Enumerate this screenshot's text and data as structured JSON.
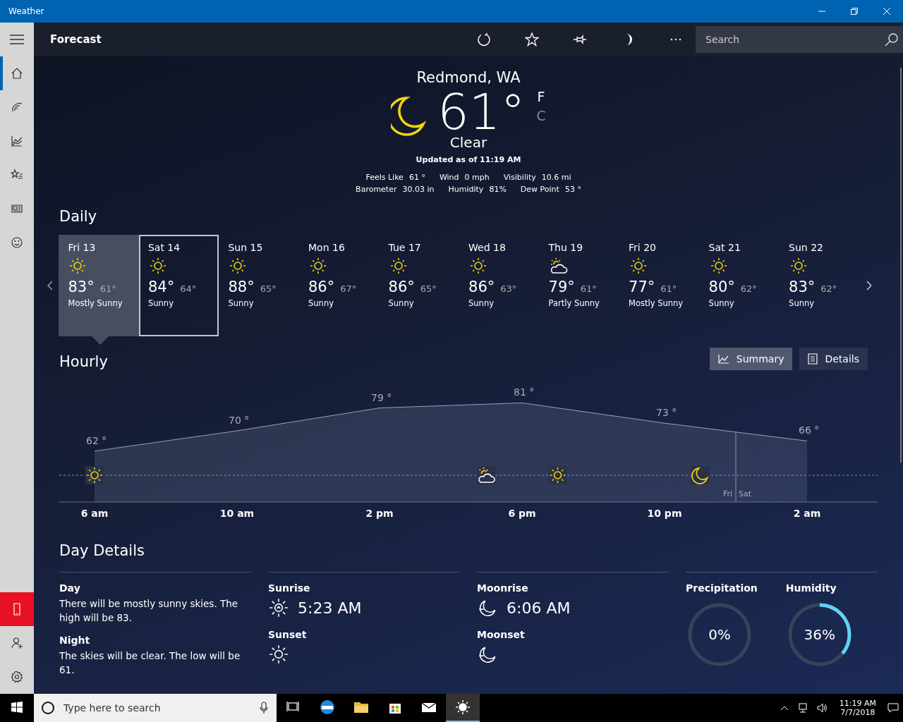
{
  "window": {
    "title": "Weather"
  },
  "sidebar": {
    "items": [
      {
        "selected": true
      },
      {
        "selected": false
      },
      {
        "selected": false
      },
      {
        "selected": false
      },
      {
        "selected": false
      },
      {
        "selected": false
      }
    ],
    "bottom_items": [
      {
        "highlighted": true
      },
      {
        "highlighted": false
      },
      {
        "highlighted": false
      }
    ]
  },
  "header": {
    "title": "Forecast",
    "search": {
      "placeholder": "Search"
    }
  },
  "current": {
    "location": "Redmond, WA",
    "temperature": "61°",
    "units": [
      {
        "label": "F",
        "selected": true
      },
      {
        "label": "C",
        "selected": false
      }
    ],
    "condition": "Clear",
    "updated": "Updated as of 11:19 AM",
    "details": [
      {
        "label": "Feels Like",
        "value": "61 °"
      },
      {
        "label": "Wind",
        "value": "0 mph"
      },
      {
        "label": "Visibility",
        "value": "10.6 mi"
      },
      {
        "label": "Barometer",
        "value": "30.03 in"
      },
      {
        "label": "Humidity",
        "value": "81%"
      },
      {
        "label": "Dew Point",
        "value": "53 °"
      }
    ]
  },
  "daily": {
    "title": "Daily",
    "days": [
      {
        "day": "Fri 13",
        "kind": "sunny",
        "high": "83°",
        "low": "61°",
        "summary": "Mostly Sunny",
        "selected": true,
        "focused": false
      },
      {
        "day": "Sat 14",
        "kind": "sunny",
        "high": "84°",
        "low": "64°",
        "summary": "Sunny",
        "selected": false,
        "focused": true
      },
      {
        "day": "Sun 15",
        "kind": "sunny",
        "high": "88°",
        "low": "65°",
        "summary": "Sunny",
        "selected": false,
        "focused": false
      },
      {
        "day": "Mon 16",
        "kind": "sunny",
        "high": "86°",
        "low": "67°",
        "summary": "Sunny",
        "selected": false,
        "focused": false
      },
      {
        "day": "Tue 17",
        "kind": "sunny",
        "high": "86°",
        "low": "65°",
        "summary": "Sunny",
        "selected": false,
        "focused": false
      },
      {
        "day": "Wed 18",
        "kind": "sunny",
        "high": "86°",
        "low": "63°",
        "summary": "Sunny",
        "selected": false,
        "focused": false
      },
      {
        "day": "Thu 19",
        "kind": "partly-sunny",
        "high": "79°",
        "low": "61°",
        "summary": "Partly Sunny",
        "selected": false,
        "focused": false
      },
      {
        "day": "Fri 20",
        "kind": "sunny",
        "high": "77°",
        "low": "61°",
        "summary": "Mostly Sunny",
        "selected": false,
        "focused": false
      },
      {
        "day": "Sat 21",
        "kind": "sunny",
        "high": "80°",
        "low": "62°",
        "summary": "Sunny",
        "selected": false,
        "focused": false
      },
      {
        "day": "Sun 22",
        "kind": "sunny",
        "high": "83°",
        "low": "62°",
        "summary": "Sunny",
        "selected": false,
        "focused": false
      }
    ]
  },
  "hourly": {
    "title": "Hourly",
    "views": [
      {
        "label": "Summary",
        "selected": true
      },
      {
        "label": "Details",
        "selected": false
      }
    ],
    "chart_data": {
      "type": "area",
      "categories": [
        "6 am",
        "10 am",
        "2 pm",
        "6 pm",
        "10 pm",
        "2 am"
      ],
      "values": [
        62,
        70,
        79,
        81,
        73,
        66
      ],
      "data_labels": true,
      "value_labels": [
        "62 °",
        "70 °",
        "79 °",
        "81 °",
        "73 °",
        "66 °"
      ]
    },
    "conditions": [
      {
        "kind": "sunny"
      },
      {
        "kind": "partly-sunny"
      },
      {
        "kind": "sunny"
      },
      {
        "kind": "moon"
      }
    ],
    "day_break": {
      "before": "Fri",
      "after": "Sat"
    }
  },
  "day_details": {
    "title": "Day Details",
    "text": [
      {
        "label": "Day",
        "body": "There will be mostly sunny skies. The high will be 83."
      },
      {
        "label": "Night",
        "body": "The skies will be clear. The low will be 61."
      }
    ],
    "sun": [
      {
        "label": "Sunrise",
        "value": "5:23 AM"
      },
      {
        "label": "Sunset"
      }
    ],
    "moon": [
      {
        "label": "Moonrise",
        "value": "6:06 AM"
      },
      {
        "label": "Moonset"
      }
    ],
    "gauges": [
      {
        "label": "Precipitation",
        "value": "0%",
        "level": 0
      },
      {
        "label": "Humidity",
        "value": "36%",
        "level": 0.36
      }
    ]
  },
  "taskbar": {
    "search": {
      "placeholder": "Type here to search"
    },
    "apps": [
      {
        "active": false
      },
      {
        "active": false
      },
      {
        "active": false
      },
      {
        "active": false
      },
      {
        "active": false
      },
      {
        "active": true
      }
    ],
    "time": "11:19 AM",
    "date": "7/7/2018"
  }
}
